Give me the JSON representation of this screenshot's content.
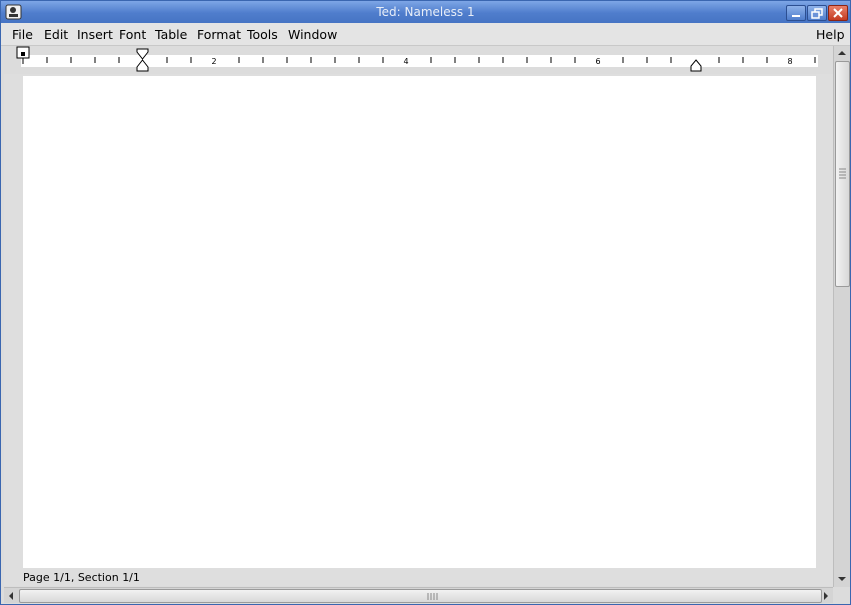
{
  "window": {
    "title": "Ted: Nameless 1"
  },
  "menubar": {
    "items": [
      {
        "label": "File"
      },
      {
        "label": "Edit"
      },
      {
        "label": "Insert"
      },
      {
        "label": "Font"
      },
      {
        "label": "Table"
      },
      {
        "label": "Format"
      },
      {
        "label": "Tools"
      },
      {
        "label": "Window"
      }
    ],
    "help": "Help"
  },
  "ruler": {
    "labels": [
      "2",
      "4",
      "6",
      "8"
    ]
  },
  "status": {
    "text": "Page 1/1, Section 1/1"
  },
  "icons": {
    "app": "app-icon",
    "minimize": "minimize-icon",
    "maximize": "maximize-icon",
    "close": "close-icon"
  },
  "colors": {
    "titlebar": "#4f7dcc",
    "close_button": "#c43b22",
    "page": "#ffffff"
  }
}
